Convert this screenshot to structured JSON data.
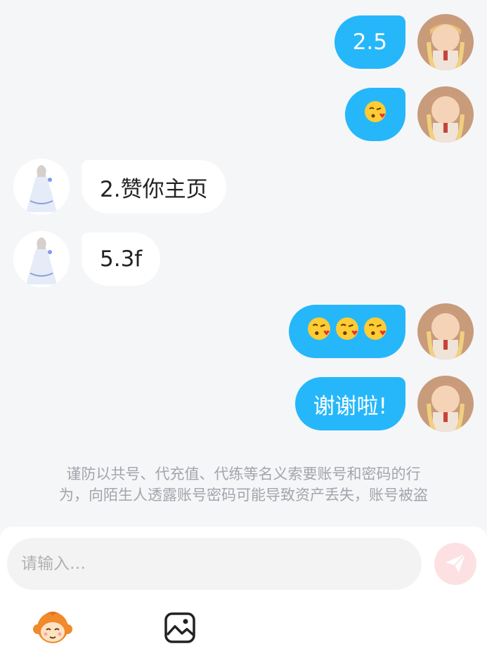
{
  "messages": [
    {
      "side": "right",
      "text": "2.5"
    },
    {
      "side": "right",
      "emoji_count": 1,
      "emoji": "kissing-face-with-heart"
    },
    {
      "side": "left",
      "text": "2.赞你主页"
    },
    {
      "side": "left",
      "text": "5.3f"
    },
    {
      "side": "right",
      "emoji_count": 3,
      "emoji": "kissing-face-with-heart"
    },
    {
      "side": "right",
      "text": "谢谢啦!"
    }
  ],
  "notice": {
    "line1": "谨防以共号、代充值、代练等名义索要账号和密码的行",
    "line2": "为，向陌生人透露账号密码可能导致资产丢失，账号被盗"
  },
  "composer": {
    "placeholder": "请输入…",
    "send_icon": "paper-plane-icon",
    "tools": [
      "monkey-sticker-icon",
      "image-icon"
    ]
  },
  "colors": {
    "bubble_sent": "#25b7fa",
    "bubble_received": "#ffffff",
    "background": "#f5f6f8",
    "send_button": "#fde1e2",
    "notice_text": "#a2a5ab"
  }
}
